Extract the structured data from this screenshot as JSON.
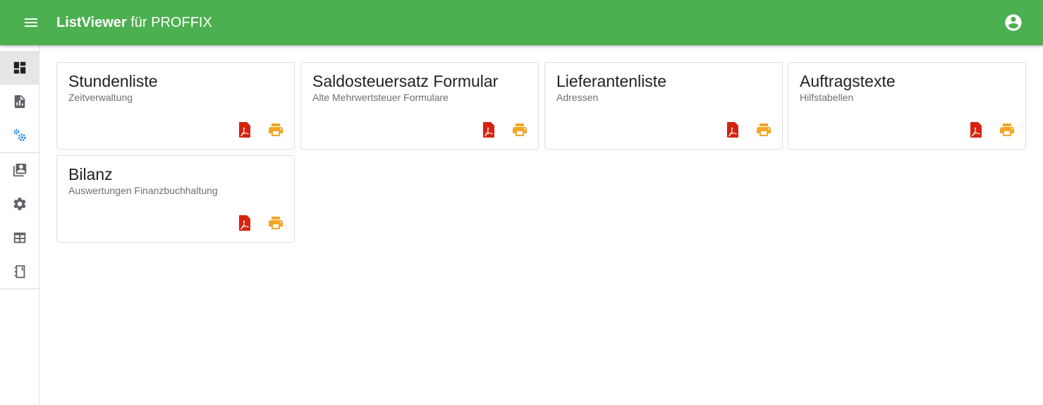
{
  "colors": {
    "brand": "#4caf50",
    "pdf": "#d6230f",
    "print": "#f5a623",
    "nav_icon": "#5f6368",
    "nav_accent": "#1e88e5"
  },
  "appbar": {
    "menu_icon": "hamburger-menu-icon",
    "title_strong": "ListViewer",
    "title_rest": " für PROFFIX",
    "account_icon": "account-circle-icon"
  },
  "sidebar": {
    "items": [
      {
        "icon": "dashboard-icon",
        "active": true
      },
      {
        "icon": "report-document-icon",
        "active": false
      },
      {
        "icon": "settings-gears-icon",
        "active": false
      },
      {
        "icon": "contacts-list-icon",
        "active": false
      },
      {
        "icon": "settings-gear-icon",
        "active": false
      },
      {
        "icon": "table-icon",
        "active": false
      },
      {
        "icon": "notebook-icon",
        "active": false
      }
    ]
  },
  "cards": [
    {
      "title": "Stundenliste",
      "subtitle": "Zeitverwaltung"
    },
    {
      "title": "Saldosteuersatz Formular",
      "subtitle": "Alte Mehrwertsteuer Formulare"
    },
    {
      "title": "Lieferantenliste",
      "subtitle": "Adressen"
    },
    {
      "title": "Auftragstexte",
      "subtitle": "Hilfstabellen"
    },
    {
      "title": "Bilanz",
      "subtitle": "Auswertungen Finanzbuchhaltung"
    }
  ],
  "card_actions": {
    "pdf_icon": "pdf-file-icon",
    "print_icon": "printer-icon"
  }
}
